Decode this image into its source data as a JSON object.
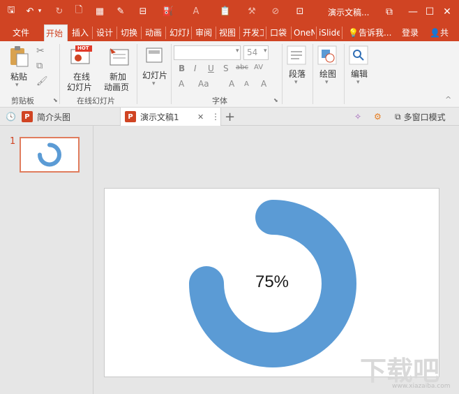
{
  "titlebar": {
    "doc_title": "演示文稿...",
    "qa": {
      "save": "🖫",
      "undo": "↶",
      "undo_arrow": "▾",
      "redo": "↻",
      "new": "🗋",
      "grid": "▦",
      "picker": "✎",
      "layout": "⊟",
      "fill": "⛽",
      "font": "A",
      "paste": "📋",
      "brush": "⚒",
      "shape": "⊘",
      "select": "⊡"
    },
    "restore": "⧉",
    "minimize": "—",
    "maximize": "☐",
    "close": "✕"
  },
  "tabs": [
    {
      "label": "文件"
    },
    {
      "label": "开始"
    },
    {
      "label": "插入"
    },
    {
      "label": "设计"
    },
    {
      "label": "切换"
    },
    {
      "label": "动画"
    },
    {
      "label": "幻灯片"
    },
    {
      "label": "审阅"
    },
    {
      "label": "视图"
    },
    {
      "label": "开发工具"
    },
    {
      "label": "口袋"
    },
    {
      "label": "OneNote"
    },
    {
      "label": "iSlide"
    }
  ],
  "tell_me": "告诉我...",
  "login": "登录",
  "share": "共",
  "ribbon": {
    "paste": "粘贴",
    "cut_icon": "✂",
    "copy_icon": "⧉",
    "format_icon": "🖌",
    "online_slides_1": "在线",
    "online_slides_2": "幻灯片",
    "hot": "HOT",
    "new_anim_1": "新加",
    "new_anim_2": "动画页",
    "slides": "幻灯片",
    "font_size": "54",
    "bold": "B",
    "italic": "I",
    "underline": "U",
    "shadow": "S",
    "strike": "abc",
    "spacing": "AV",
    "font_color": "A",
    "case": "Aa",
    "grow": "A",
    "shrink": "A",
    "clear": "A",
    "paragraph": "段落",
    "drawing": "绘图",
    "editing": "编辑",
    "group_clipboard": "剪贴板",
    "group_online": "在线幻灯片",
    "group_font": "字体",
    "collapse": "^"
  },
  "doc_tabs": [
    {
      "label": "简介头图"
    },
    {
      "label": "演示文稿1"
    }
  ],
  "doctab_close": "✕",
  "doctab_more": "⋮",
  "doctab_add": "+",
  "multi_window": "多窗口模式",
  "slide_panel": {
    "number": "1"
  },
  "slide": {
    "percent_label": "75%"
  },
  "watermark": {
    "big": "下载吧",
    "small": "www.xiazaiba.com"
  },
  "colors": {
    "accent": "#d04423",
    "ring": "#5b9bd5",
    "ribbon_bg": "#f3f3f3"
  }
}
